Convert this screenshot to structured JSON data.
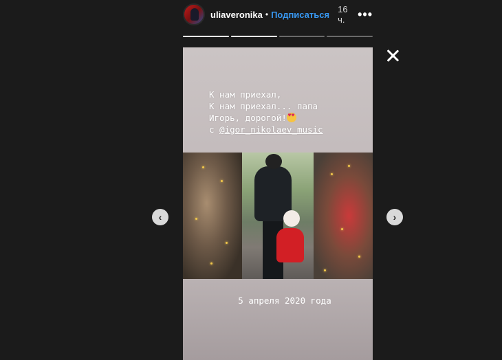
{
  "header": {
    "username": "uliaveronika",
    "separator": "•",
    "follow_label": "Подписаться",
    "time": "16 ч.",
    "more_label": "•••",
    "avatar_icon": "avatar-image"
  },
  "progress": {
    "segments": 4,
    "completed": 2
  },
  "story": {
    "caption_lines": [
      "К нам приехал,",
      "К нам приехал... папа",
      "Игорь, дорогой!"
    ],
    "caption_prefix": "с ",
    "mention": "@igor_nikolaev_music",
    "emoji": "heart-eyes-emoji",
    "date": "5 апреля 2020 года"
  },
  "controls": {
    "close_icon": "close-icon",
    "prev_icon": "chevron-left-icon",
    "prev_glyph": "‹",
    "next_icon": "chevron-right-icon",
    "next_glyph": "›"
  },
  "colors": {
    "background": "#1b1b1b",
    "link": "#3897f0",
    "story_bg": "#c4bdbe"
  }
}
